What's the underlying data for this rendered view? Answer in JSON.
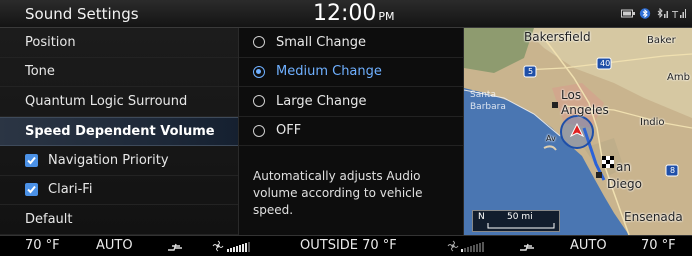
{
  "header": {
    "title": "Sound Settings",
    "time": "12:00",
    "ampm": "PM",
    "status_icons": [
      "battery-icon",
      "bluetooth-icon",
      "bluetooth-audio-icon",
      "signal-icon"
    ]
  },
  "menu": {
    "items": [
      {
        "label": "Position",
        "type": "item"
      },
      {
        "label": "Tone",
        "type": "item"
      },
      {
        "label": "Quantum Logic Surround",
        "type": "item"
      },
      {
        "label": "Speed Dependent Volume",
        "type": "selected"
      },
      {
        "label": "Navigation Priority",
        "type": "checkbox",
        "checked": true
      },
      {
        "label": "Clari-Fi",
        "type": "checkbox",
        "checked": true
      },
      {
        "label": "Default",
        "type": "item"
      }
    ]
  },
  "options": {
    "items": [
      {
        "label": "Small Change",
        "selected": false
      },
      {
        "label": "Medium Change",
        "selected": true
      },
      {
        "label": "Large Change",
        "selected": false
      },
      {
        "label": "OFF",
        "selected": false
      }
    ],
    "description": "Automatically adjusts Audio volume according to vehicle speed."
  },
  "map": {
    "labels": {
      "bakersfield": "Bakersfield",
      "baker": "Baker",
      "amb": "Amb",
      "los": "Los",
      "angeles": "Angeles",
      "santa": "Santa",
      "barbara": "Barbara",
      "indio": "Indio",
      "an": "an",
      "diego": "Diego",
      "ensenada": "Ensenada",
      "avalon": "Av",
      "highway_5": "5",
      "highway_40": "40",
      "highway_8": "8"
    },
    "scale_label": "50 mi",
    "north_label": "N"
  },
  "climate": {
    "left_temp": "70 °F",
    "left_mode": "AUTO",
    "outside": "OUTSIDE  70 °F",
    "right_mode": "AUTO",
    "right_temp": "70 °F",
    "left_fan_level": 7,
    "right_fan_level": 1,
    "fan_max": 8
  },
  "colors": {
    "accent": "#6fb0ff",
    "checkbox": "#4b91e6",
    "selected_row": "#1d2838"
  }
}
